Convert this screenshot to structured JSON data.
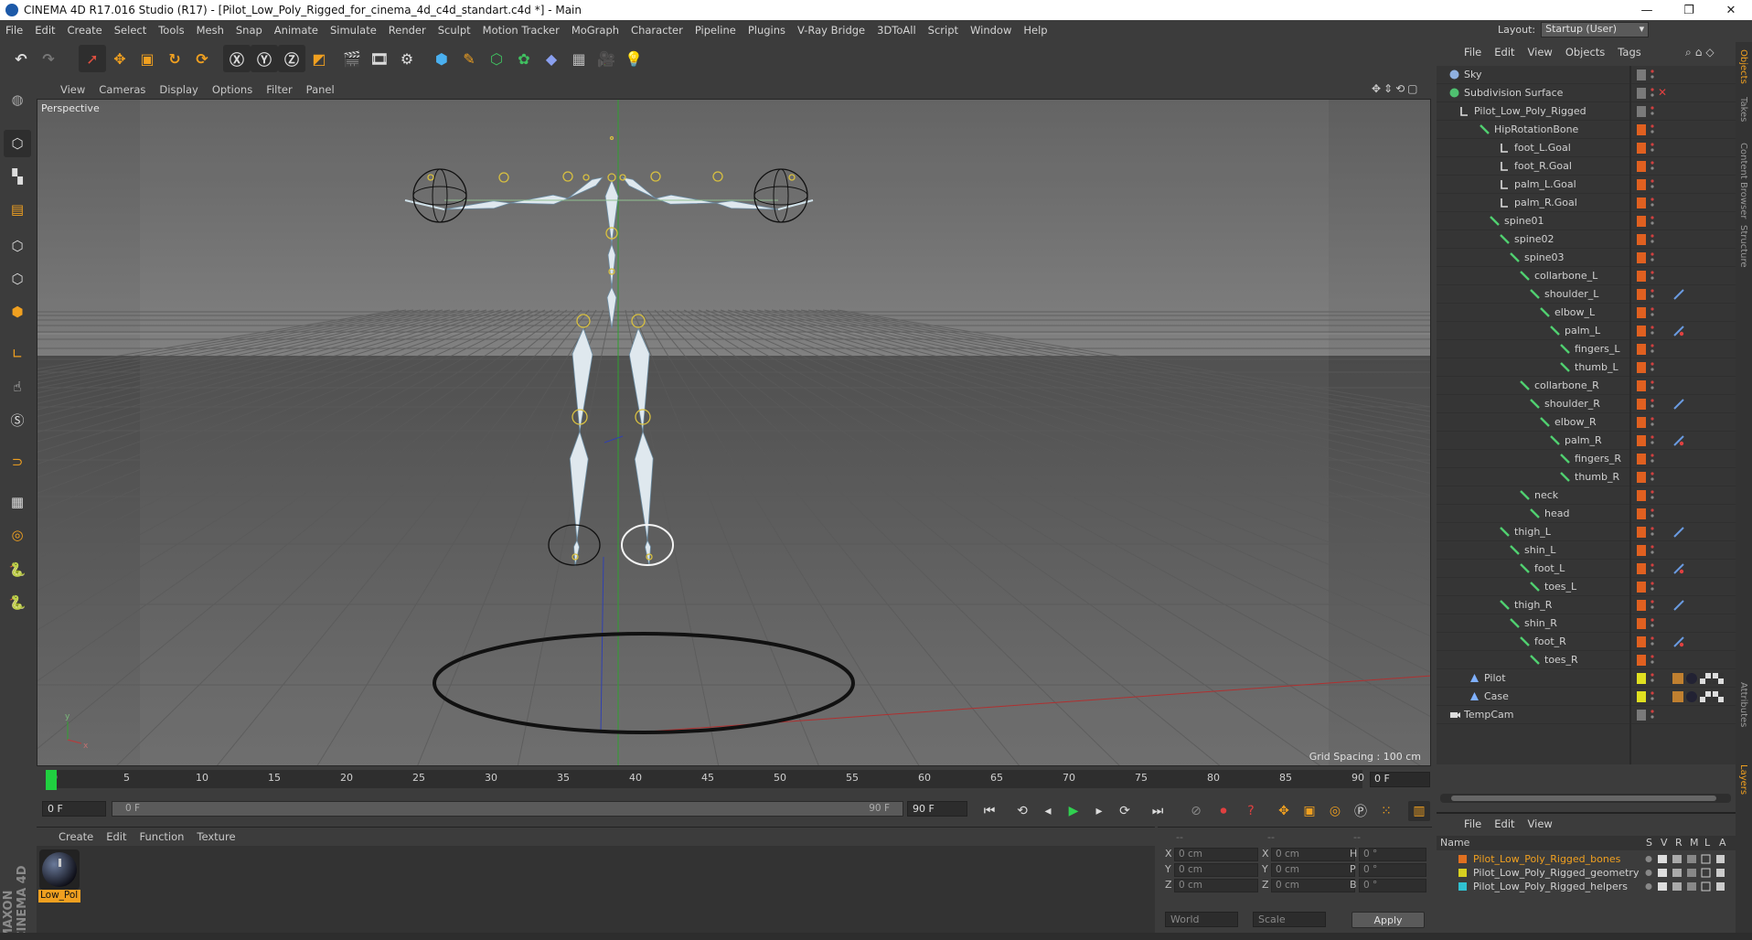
{
  "window": {
    "title": "CINEMA 4D R17.016 Studio (R17) - [Pilot_Low_Poly_Rigged_for_cinema_4d_c4d_standart.c4d *] - Main"
  },
  "menubar": [
    "File",
    "Edit",
    "Create",
    "Select",
    "Tools",
    "Mesh",
    "Snap",
    "Animate",
    "Simulate",
    "Render",
    "Sculpt",
    "Motion Tracker",
    "MoGraph",
    "Character",
    "Pipeline",
    "Plugins",
    "V-Ray Bridge",
    "3DToAll",
    "Script",
    "Window",
    "Help"
  ],
  "layout": {
    "label": "Layout:",
    "value": "Startup (User)"
  },
  "viewport": {
    "menu": [
      "View",
      "Cameras",
      "Display",
      "Options",
      "Filter",
      "Panel"
    ],
    "label": "Perspective",
    "grid_spacing": "Grid Spacing : 100 cm"
  },
  "timeline": {
    "ticks": [
      "0",
      "5",
      "10",
      "15",
      "20",
      "25",
      "30",
      "35",
      "40",
      "45",
      "50",
      "55",
      "60",
      "65",
      "70",
      "75",
      "80",
      "85",
      "90"
    ],
    "current": "0 F",
    "start": "0 F",
    "range_start": "0 F",
    "range_end": "90 F",
    "end": "90 F"
  },
  "material": {
    "menu": [
      "Create",
      "Edit",
      "Function",
      "Texture"
    ],
    "name": "Low_Pol"
  },
  "coordinates": {
    "headers": [
      "--",
      "--",
      "--"
    ],
    "rows": [
      {
        "a": "X",
        "av": "0 cm",
        "b": "X",
        "bv": "0 cm",
        "c": "H",
        "cv": "0 °"
      },
      {
        "a": "Y",
        "av": "0 cm",
        "b": "Y",
        "bv": "0 cm",
        "c": "P",
        "cv": "0 °"
      },
      {
        "a": "Z",
        "av": "0 cm",
        "b": "Z",
        "bv": "0 cm",
        "c": "B",
        "cv": "0 °"
      }
    ],
    "space": "World",
    "mode": "Scale",
    "apply": "Apply"
  },
  "objects": {
    "menu": [
      "File",
      "Edit",
      "View",
      "Objects",
      "Tags"
    ],
    "items": [
      {
        "name": "Sky",
        "depth": 0,
        "icon": "sky-icon",
        "color": "#8fb0e0",
        "tag": ""
      },
      {
        "name": "Subdivision Surface",
        "depth": 0,
        "icon": "subdivision-icon",
        "color": "#4fc070",
        "tag": ""
      },
      {
        "name": "Pilot_Low_Poly_Rigged",
        "depth": 1,
        "icon": "null-icon",
        "color": "#dddddd",
        "tag": ""
      },
      {
        "name": "HipRotationBone",
        "depth": 3,
        "icon": "bone-icon",
        "color": "#50d070",
        "tag": ""
      },
      {
        "name": "foot_L.Goal",
        "depth": 5,
        "icon": "null-icon",
        "color": "#dddddd",
        "tag": ""
      },
      {
        "name": "foot_R.Goal",
        "depth": 5,
        "icon": "null-icon",
        "color": "#dddddd",
        "tag": ""
      },
      {
        "name": "palm_L.Goal",
        "depth": 5,
        "icon": "null-icon",
        "color": "#dddddd",
        "tag": ""
      },
      {
        "name": "palm_R.Goal",
        "depth": 5,
        "icon": "null-icon",
        "color": "#dddddd",
        "tag": ""
      },
      {
        "name": "spine01",
        "depth": 4,
        "icon": "bone-icon",
        "color": "#50d070",
        "tag": ""
      },
      {
        "name": "spine02",
        "depth": 5,
        "icon": "bone-icon",
        "color": "#50d070",
        "tag": ""
      },
      {
        "name": "spine03",
        "depth": 6,
        "icon": "bone-icon",
        "color": "#50d070",
        "tag": ""
      },
      {
        "name": "collarbone_L",
        "depth": 7,
        "icon": "bone-icon",
        "color": "#50d070",
        "tag": ""
      },
      {
        "name": "shoulder_L",
        "depth": 8,
        "icon": "bone-icon",
        "color": "#50d070",
        "tag": "ik"
      },
      {
        "name": "elbow_L",
        "depth": 9,
        "icon": "bone-icon",
        "color": "#50d070",
        "tag": ""
      },
      {
        "name": "palm_L",
        "depth": 10,
        "icon": "bone-icon",
        "color": "#50d070",
        "tag": "ik2"
      },
      {
        "name": "fingers_L",
        "depth": 11,
        "icon": "bone-icon",
        "color": "#50d070",
        "tag": ""
      },
      {
        "name": "thumb_L",
        "depth": 11,
        "icon": "bone-icon",
        "color": "#50d070",
        "tag": ""
      },
      {
        "name": "collarbone_R",
        "depth": 7,
        "icon": "bone-icon",
        "color": "#50d070",
        "tag": ""
      },
      {
        "name": "shoulder_R",
        "depth": 8,
        "icon": "bone-icon",
        "color": "#50d070",
        "tag": "ik"
      },
      {
        "name": "elbow_R",
        "depth": 9,
        "icon": "bone-icon",
        "color": "#50d070",
        "tag": ""
      },
      {
        "name": "palm_R",
        "depth": 10,
        "icon": "bone-icon",
        "color": "#50d070",
        "tag": "ik2"
      },
      {
        "name": "fingers_R",
        "depth": 11,
        "icon": "bone-icon",
        "color": "#50d070",
        "tag": ""
      },
      {
        "name": "thumb_R",
        "depth": 11,
        "icon": "bone-icon",
        "color": "#50d070",
        "tag": ""
      },
      {
        "name": "neck",
        "depth": 7,
        "icon": "bone-icon",
        "color": "#50d070",
        "tag": ""
      },
      {
        "name": "head",
        "depth": 8,
        "icon": "bone-icon",
        "color": "#50d070",
        "tag": ""
      },
      {
        "name": "thigh_L",
        "depth": 5,
        "icon": "bone-icon",
        "color": "#50d070",
        "tag": "ik"
      },
      {
        "name": "shin_L",
        "depth": 6,
        "icon": "bone-icon",
        "color": "#50d070",
        "tag": ""
      },
      {
        "name": "foot_L",
        "depth": 7,
        "icon": "bone-icon",
        "color": "#50d070",
        "tag": "ik2"
      },
      {
        "name": "toes_L",
        "depth": 8,
        "icon": "bone-icon",
        "color": "#50d070",
        "tag": ""
      },
      {
        "name": "thigh_R",
        "depth": 5,
        "icon": "bone-icon",
        "color": "#50d070",
        "tag": "ik"
      },
      {
        "name": "shin_R",
        "depth": 6,
        "icon": "bone-icon",
        "color": "#50d070",
        "tag": ""
      },
      {
        "name": "foot_R",
        "depth": 7,
        "icon": "bone-icon",
        "color": "#50d070",
        "tag": "ik2"
      },
      {
        "name": "toes_R",
        "depth": 8,
        "icon": "bone-icon",
        "color": "#50d070",
        "tag": ""
      },
      {
        "name": "Pilot",
        "depth": 2,
        "icon": "polygon-icon",
        "color": "#7fb0ff",
        "tag": "mat"
      },
      {
        "name": "Case",
        "depth": 2,
        "icon": "polygon-icon",
        "color": "#7fb0ff",
        "tag": "mat"
      },
      {
        "name": "TempCam",
        "depth": 0,
        "icon": "camera-icon",
        "color": "#dddddd",
        "tag": ""
      }
    ]
  },
  "layers": {
    "menu": [
      "File",
      "Edit",
      "View"
    ],
    "header": {
      "name": "Name",
      "cols": [
        "S",
        "V",
        "R",
        "M",
        "L",
        "A"
      ]
    },
    "items": [
      {
        "name": "Pilot_Low_Poly_Rigged_bones",
        "color": "#e07020",
        "text": "#f0a020"
      },
      {
        "name": "Pilot_Low_Poly_Rigged_geometry",
        "color": "#d8d020",
        "text": "#d0d0d0"
      },
      {
        "name": "Pilot_Low_Poly_Rigged_helpers",
        "color": "#30c0d0",
        "text": "#d0d0d0"
      }
    ]
  },
  "sidetabs": [
    "Objects",
    "Takes",
    "Content Browser",
    "Structure",
    "Attributes",
    "Layers"
  ],
  "brand": "MAXON CINEMA 4D"
}
